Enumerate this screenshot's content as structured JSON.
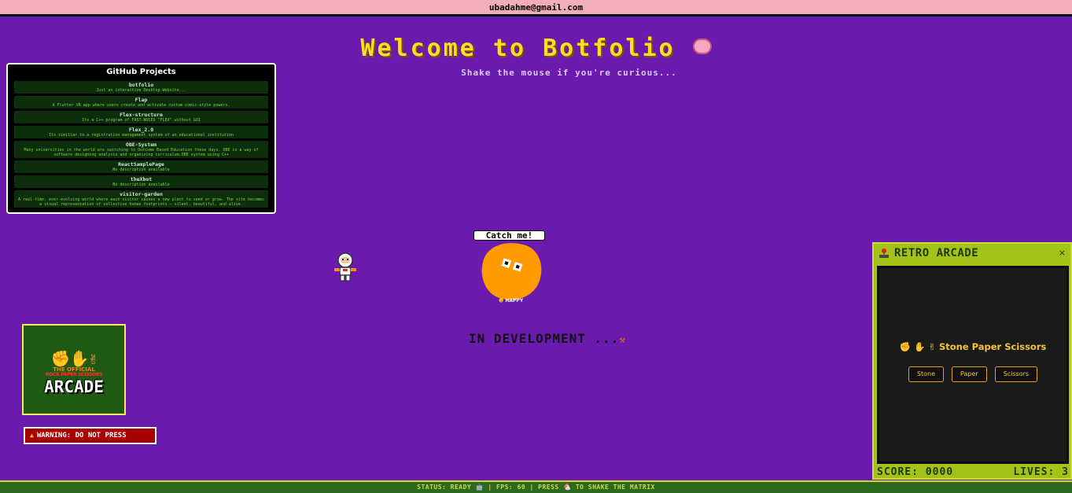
{
  "header": {
    "email": "ubadahme@gmail.com"
  },
  "hero": {
    "title": "Welcome to Botfolio",
    "subtitle": "Shake the mouse if you're curious..."
  },
  "github": {
    "title": "GitHub Projects",
    "projects": [
      {
        "name": "botfolio",
        "desc": "Just an interactive Desktop-Website..."
      },
      {
        "name": "Flap",
        "desc": "A Flutter VR app where users create and activate custom comic-style powers."
      },
      {
        "name": "Flex-structure",
        "desc": "Its a C++ program of FAST-NUCES \"FLEX\" without GUI"
      },
      {
        "name": "Flex_2.0",
        "desc": "Its similiar to a registration management system of an educational institution"
      },
      {
        "name": "OBE-System",
        "desc": "Many universities in the world are switching to Outcome Based Education these days. OBE is a way of software designing analysis and organizing curriculum.OBE system using C++"
      },
      {
        "name": "ReactSamplePage",
        "desc": "No description available"
      },
      {
        "name": "theXbot",
        "desc": "No description available"
      },
      {
        "name": "visitor-garden",
        "desc": "A real-time, ever-evolving world where each visitor causes a new plant to seed or grow. The site becomes a visual representation of collective human footprints — silent, beautiful, and alive."
      }
    ]
  },
  "pet": {
    "speech": "Catch me!",
    "mood": "HAPPY"
  },
  "dev_notice": "IN DEVELOPMENT ...",
  "arcade_tile": {
    "small1": "THE OFFICIAL",
    "small2": "ROCK PAPER SCISSORS",
    "big": "ARCADE"
  },
  "warning_button": "WARNING: DO NOT PRESS",
  "retro_arcade": {
    "title": "RETRO ARCADE",
    "close": "×",
    "game_title": "Stone Paper Scissors",
    "buttons": [
      "Stone",
      "Paper",
      "Scissors"
    ],
    "score": "SCORE: 0000",
    "lives": "LIVES: 3"
  },
  "status_bar": "STATUS: READY 🤖 | FPS: 60 | PRESS 🐔 TO SHAKE THE MATRIX",
  "icons": {
    "brain": "brain-icon",
    "hammer": "hammer-icon",
    "rps_hands": "rps-hands-icon",
    "joystick": "joystick-icon",
    "warning": "warning-icon",
    "astronaut": "astronaut-icon"
  },
  "colors": {
    "background": "#6a1bad",
    "accent_yellow": "#ffdd22",
    "topbar": "#f2aeb8",
    "pet": "#ff9a00",
    "arcade_panel": "#a5c21a"
  }
}
